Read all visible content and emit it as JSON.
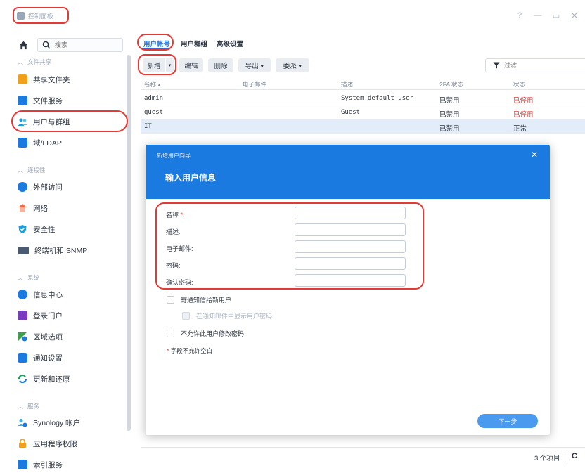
{
  "window": {
    "title": "控制面板",
    "controls": [
      "?",
      "—",
      "▭",
      "✕"
    ]
  },
  "sidebar": {
    "search_placeholder": "搜索",
    "sections": [
      {
        "title": "文件共享",
        "items": [
          {
            "label": "共享文件夹",
            "icon": "shared-folder-icon",
            "color": "#f0a01a"
          },
          {
            "label": "文件服务",
            "icon": "file-services-icon",
            "color": "#1a7ae0"
          },
          {
            "label": "用户与群组",
            "icon": "users-icon",
            "color": "#1a9be0",
            "active": true
          },
          {
            "label": "域/LDAP",
            "icon": "ldap-icon",
            "color": "#1a7ae0"
          }
        ]
      },
      {
        "title": "连接性",
        "items": [
          {
            "label": "外部访问",
            "icon": "external-access-icon",
            "color": "#1a7ae0"
          },
          {
            "label": "网络",
            "icon": "network-icon",
            "color": "#f06a4a"
          },
          {
            "label": "安全性",
            "icon": "security-icon",
            "color": "#1aa0e0"
          },
          {
            "label": "终端机和 SNMP",
            "icon": "terminal-icon",
            "color": "#4a5a70"
          }
        ]
      },
      {
        "title": "系统",
        "items": [
          {
            "label": "信息中心",
            "icon": "info-center-icon",
            "color": "#1a7ae0"
          },
          {
            "label": "登录门户",
            "icon": "login-portal-icon",
            "color": "#7a3ac0"
          },
          {
            "label": "区域选项",
            "icon": "regional-options-icon",
            "color": "#3aa04a"
          },
          {
            "label": "通知设置",
            "icon": "notification-icon",
            "color": "#1a7ae0"
          },
          {
            "label": "更新和还原",
            "icon": "update-restore-icon",
            "color": "#1aa05a"
          }
        ]
      },
      {
        "title": "服务",
        "items": [
          {
            "label": "Synology 帐户",
            "icon": "synology-account-icon",
            "color": "#3ab0e0"
          },
          {
            "label": "应用程序权限",
            "icon": "app-privileges-icon",
            "color": "#f0a01a"
          },
          {
            "label": "索引服务",
            "icon": "indexing-icon",
            "color": "#1a7ae0"
          }
        ]
      }
    ]
  },
  "tabs": [
    "用户帐号",
    "用户群组",
    "高级设置"
  ],
  "toolbar": {
    "create": "新增",
    "edit": "编辑",
    "delete": "删除",
    "export": "导出 ▾",
    "delegate": "委派 ▾",
    "filter_placeholder": "过滤"
  },
  "table": {
    "headers": [
      "名称 ▴",
      "电子邮件",
      "描述",
      "2FA 状态",
      "状态"
    ],
    "rows": [
      {
        "name": "admin",
        "email": "",
        "description": "System default user",
        "twofa": "已禁用",
        "status": "已停用",
        "status_red": true
      },
      {
        "name": "guest",
        "email": "",
        "description": "Guest",
        "twofa": "已禁用",
        "status": "已停用",
        "status_red": true
      },
      {
        "name": "IT",
        "email": "",
        "description": "",
        "twofa": "已禁用",
        "status": "正常",
        "status_red": false,
        "selected": true
      }
    ],
    "count_label": "3 个项目"
  },
  "dialog": {
    "window_title": "新增用户向导",
    "heading": "输入用户信息",
    "fields": [
      {
        "label": "名称",
        "required": true
      },
      {
        "label": "描述:"
      },
      {
        "label": "电子邮件:"
      },
      {
        "label": "密码:"
      },
      {
        "label": "确认密码:"
      }
    ],
    "name_required_mark": "*",
    "name_colon": ":",
    "checkboxes": [
      {
        "label": "寄通知信给新用户",
        "disabled": false
      },
      {
        "label": "在通知邮件中显示用户密码",
        "disabled": true
      },
      {
        "label": "不允许此用户修改密码",
        "disabled": false
      }
    ],
    "note_mark": "*",
    "note": "字段不允许空白",
    "next_button": "下一步"
  }
}
